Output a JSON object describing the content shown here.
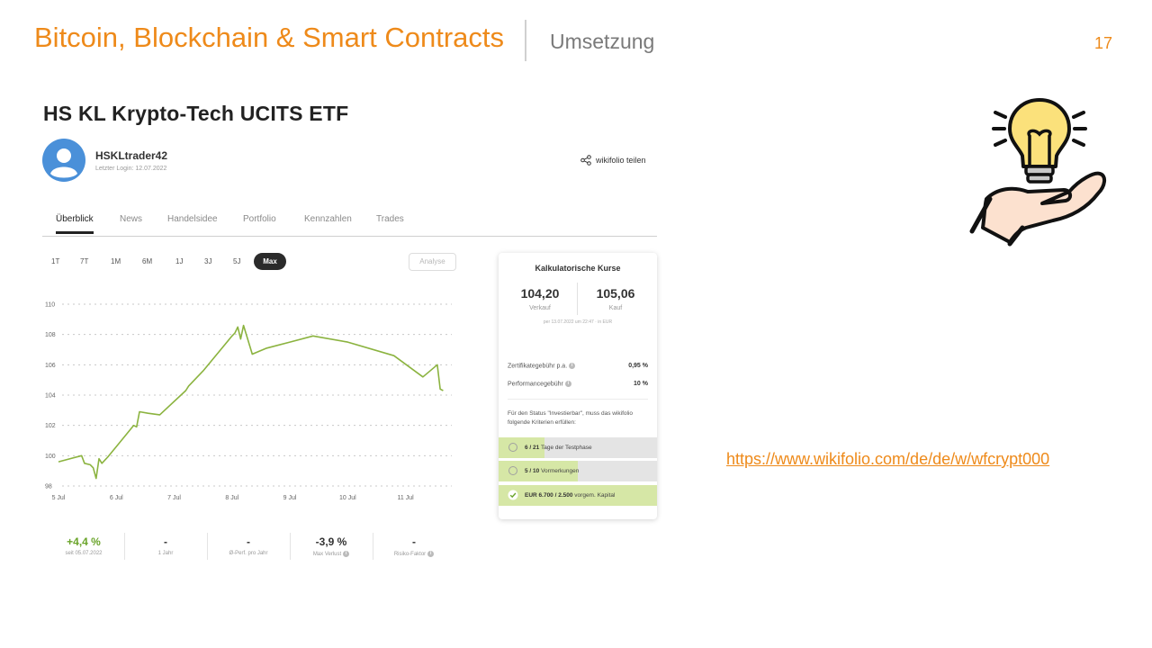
{
  "slide": {
    "title": "Bitcoin, Blockchain & Smart Contracts",
    "subtitle": "Umsetzung",
    "page_number": "17"
  },
  "colors": {
    "accent": "#ee8a1a",
    "chart_line": "#8bb33f",
    "criteria_fill": "#d6e7a6",
    "positive": "#6aa42a"
  },
  "screenshot": {
    "etf_title": "HS KL Krypto-Tech UCITS ETF",
    "trader_name": "HSKLtrader42",
    "last_login": "Letzter Login: 12.07.2022",
    "share_label": "wikifolio teilen",
    "share_icon": "share-icon",
    "tabs": [
      "Überblick",
      "News",
      "Handelsidee",
      "Portfolio",
      "Kennzahlen",
      "Trades"
    ],
    "active_tab": "Überblick",
    "ranges": [
      "1T",
      "7T",
      "1M",
      "6M",
      "1J",
      "3J",
      "5J",
      "Max"
    ],
    "active_range": "Max",
    "analyse_label": "Analyse",
    "stats": [
      {
        "value": "+4,4 %",
        "label": "seit 05.07.2022"
      },
      {
        "value": "-",
        "label": "1 Jahr"
      },
      {
        "value": "-",
        "label": "Ø-Perf. pro Jahr"
      },
      {
        "value": "-3,9 %",
        "label": "Max Verlust"
      },
      {
        "value": "-",
        "label": "Risiko-Faktor"
      }
    ],
    "card": {
      "title": "Kalkulatorische Kurse",
      "sell_price": "104,20",
      "sell_label": "Verkauf",
      "buy_price": "105,06",
      "buy_label": "Kauf",
      "timestamp": "per 13.07.2022 um 22:47 · in EUR",
      "fees": [
        {
          "label": "Zertifikategebühr p.a.",
          "value": "0,95 %"
        },
        {
          "label": "Performancegebühr",
          "value": "10 %"
        }
      ],
      "status_text": "Für den Status \"Investierbar\", muss das wikifolio folgende Kriterien erfüllen:",
      "criteria": [
        {
          "count": "6 / 21",
          "text": "Tage der Testphase",
          "progress": 0.29,
          "done": false
        },
        {
          "count": "5 / 10",
          "text": "Vormerkungen",
          "progress": 0.5,
          "done": false
        },
        {
          "count": "EUR 6.700 / 2.500",
          "text": "vorgem. Kapital",
          "progress": 1.0,
          "done": true
        }
      ]
    }
  },
  "chart_data": {
    "type": "line",
    "title": "",
    "xlabel": "",
    "ylabel": "",
    "ylim": [
      98,
      110
    ],
    "yticks": [
      98,
      100,
      102,
      104,
      106,
      108,
      110
    ],
    "xticks": [
      "5 Jul",
      "6 Jul",
      "7 Jul",
      "8 Jul",
      "9 Jul",
      "10 Jul",
      "11 Jul"
    ],
    "xlim": [
      5.0,
      11.8
    ],
    "grid": true,
    "series": [
      {
        "x": [
          5.0,
          5.4,
          5.45,
          5.55,
          5.6,
          5.65,
          5.7,
          5.75,
          5.85,
          6.3,
          6.35,
          6.4,
          6.55,
          6.75,
          7.2,
          7.25,
          7.5,
          8.0,
          8.05,
          8.1,
          8.15,
          8.2,
          8.35,
          8.6,
          9.0,
          9.4,
          10.0,
          10.8,
          11.3,
          11.55,
          11.6,
          11.65
        ],
        "y": [
          99.6,
          100.0,
          99.5,
          99.4,
          99.2,
          98.5,
          99.8,
          99.5,
          99.9,
          102.0,
          101.9,
          102.9,
          102.8,
          102.7,
          104.3,
          104.6,
          105.6,
          107.9,
          108.1,
          108.5,
          107.7,
          108.6,
          106.7,
          107.1,
          107.5,
          107.9,
          107.5,
          106.6,
          105.2,
          106.0,
          104.4,
          104.3
        ]
      }
    ]
  },
  "link": {
    "url": "https://www.wikifolio.com/de/de/w/wfcrypt000"
  }
}
